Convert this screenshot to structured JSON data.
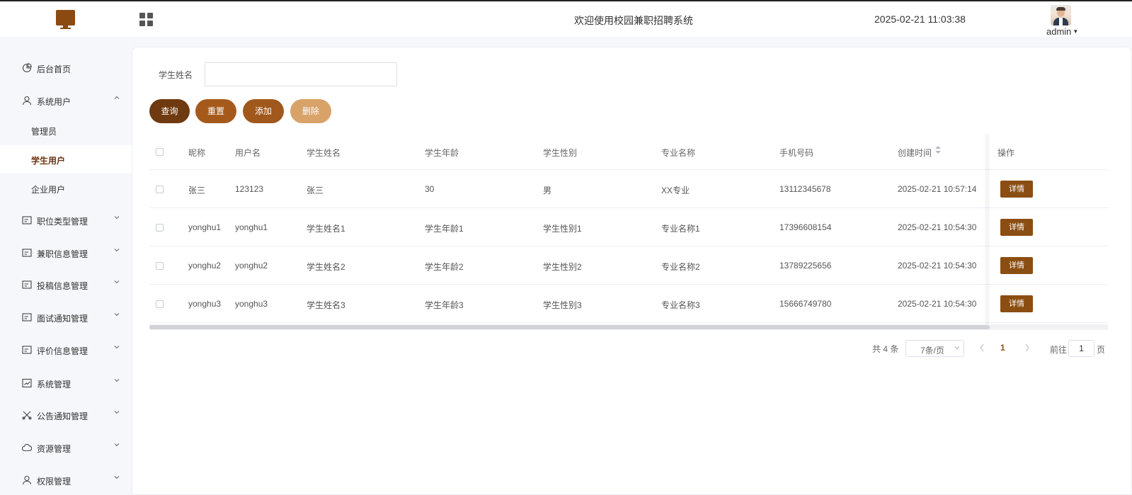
{
  "header": {
    "welcome": "欢迎使用校园兼职招聘系统",
    "datetime": "2025-02-21 11:03:38",
    "username": "admin"
  },
  "sidebar": {
    "items": [
      {
        "label": "后台首页",
        "icon": "pie-chart-icon"
      },
      {
        "label": "系统用户",
        "icon": "user-icon",
        "expanded": true
      },
      {
        "label": "职位类型管理",
        "icon": "list-icon"
      },
      {
        "label": "兼职信息管理",
        "icon": "list-icon"
      },
      {
        "label": "投稿信息管理",
        "icon": "list-icon"
      },
      {
        "label": "面试通知管理",
        "icon": "list-icon"
      },
      {
        "label": "评价信息管理",
        "icon": "list-icon"
      },
      {
        "label": "系统管理",
        "icon": "chart-box-icon"
      },
      {
        "label": "公告通知管理",
        "icon": "scissors-icon"
      },
      {
        "label": "资源管理",
        "icon": "cloud-icon"
      },
      {
        "label": "权限管理",
        "icon": "user-icon"
      }
    ],
    "submenu": [
      {
        "label": "管理员"
      },
      {
        "label": "学生用户",
        "active": true
      },
      {
        "label": "企业用户"
      }
    ]
  },
  "search": {
    "label": "学生姓名",
    "value": "",
    "placeholder": ""
  },
  "buttons": {
    "query": "查询",
    "reset": "重置",
    "add": "添加",
    "delete": "删除"
  },
  "table": {
    "columns": [
      "昵称",
      "用户名",
      "学生姓名",
      "学生年龄",
      "学生性别",
      "专业名称",
      "手机号码",
      "创建时间",
      "操作"
    ],
    "rows": [
      [
        "张三",
        "123123",
        "张三",
        "30",
        "男",
        "XX专业",
        "13112345678",
        "2025-02-21 10:57:14"
      ],
      [
        "yonghu1",
        "yonghu1",
        "学生姓名1",
        "学生年龄1",
        "学生性别1",
        "专业名称1",
        "17396608154",
        "2025-02-21 10:54:30"
      ],
      [
        "yonghu2",
        "yonghu2",
        "学生姓名2",
        "学生年龄2",
        "学生性别2",
        "专业名称2",
        "13789225656",
        "2025-02-21 10:54:30"
      ],
      [
        "yonghu3",
        "yonghu3",
        "学生姓名3",
        "学生年龄3",
        "学生性别3",
        "专业名称3",
        "15666749780",
        "2025-02-21 10:54:30"
      ]
    ],
    "action_label": "详情"
  },
  "pagination": {
    "total": "共 4 条",
    "page_size": "7条/页",
    "current_page": "1",
    "goto_prefix": "前往",
    "goto_value": "1",
    "goto_suffix": "页"
  },
  "colors": {
    "brand": "#8b4e12",
    "query_button": "#6f3a10",
    "reset_button": "#a55a1c",
    "add_button": "#a0581c",
    "delete_button": "#d8a269"
  }
}
